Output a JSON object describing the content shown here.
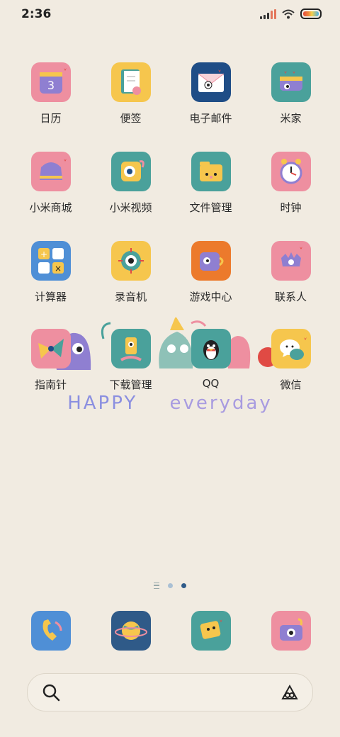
{
  "status": {
    "time": "2:36"
  },
  "apps": [
    {
      "label": "日历",
      "icon": "calendar-icon",
      "color": "#ee8fa0"
    },
    {
      "label": "便签",
      "icon": "notes-icon",
      "color": "#f6c64d"
    },
    {
      "label": "电子邮件",
      "icon": "email-icon",
      "color": "#1f4d86"
    },
    {
      "label": "米家",
      "icon": "mijia-icon",
      "color": "#4aa19b"
    },
    {
      "label": "小米商城",
      "icon": "mall-icon",
      "color": "#ee8fa0"
    },
    {
      "label": "小米视频",
      "icon": "video-icon",
      "color": "#4aa19b"
    },
    {
      "label": "文件管理",
      "icon": "file-manager-icon",
      "color": "#4aa19b"
    },
    {
      "label": "时钟",
      "icon": "clock-icon",
      "color": "#ee8fa0"
    },
    {
      "label": "计算器",
      "icon": "calculator-icon",
      "color": "#4f8fd6"
    },
    {
      "label": "录音机",
      "icon": "recorder-icon",
      "color": "#f6c64d"
    },
    {
      "label": "游戏中心",
      "icon": "game-center-icon",
      "color": "#ec7a2c"
    },
    {
      "label": "联系人",
      "icon": "contacts-icon",
      "color": "#ee8fa0"
    },
    {
      "label": "指南针",
      "icon": "compass-icon",
      "color": "#ee8fa0"
    },
    {
      "label": "下载管理",
      "icon": "download-icon",
      "color": "#4aa19b"
    },
    {
      "label": "QQ",
      "icon": "qq-icon",
      "color": "#4aa19b"
    },
    {
      "label": "微信",
      "icon": "wechat-icon",
      "color": "#f6c64d"
    }
  ],
  "banner": {
    "word1": "HAPPY",
    "word2": "everyday"
  },
  "dock": [
    {
      "icon": "phone-icon",
      "color": "#4f8fd6"
    },
    {
      "icon": "browser-icon",
      "color": "#2f5a88"
    },
    {
      "icon": "messages-icon",
      "color": "#4aa19b"
    },
    {
      "icon": "camera-icon",
      "color": "#ee8fa0"
    }
  ],
  "search": {
    "icon": "search-icon",
    "assistant_icon": "assistant-icon"
  }
}
